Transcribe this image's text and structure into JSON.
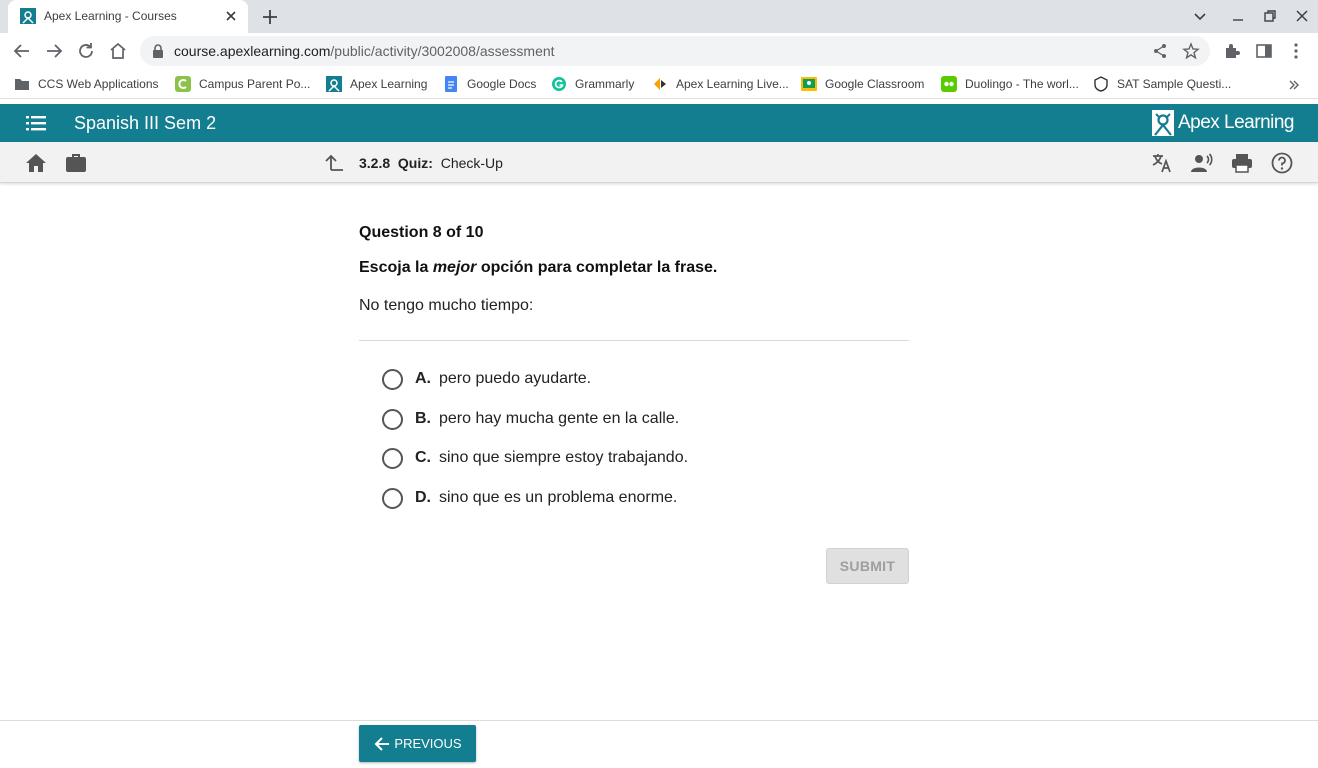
{
  "browser": {
    "tab_title": "Apex Learning - Courses",
    "url_host": "course.apexlearning.com",
    "url_path": "/public/activity/3002008/assessment"
  },
  "bookmarks": [
    {
      "label": "CCS Web Applications",
      "icon": "folder-icon"
    },
    {
      "label": "Campus Parent Po...",
      "icon": "campus-icon"
    },
    {
      "label": "Apex Learning",
      "icon": "apex-icon"
    },
    {
      "label": "Google Docs",
      "icon": "docs-icon"
    },
    {
      "label": "Grammarly",
      "icon": "grammarly-icon"
    },
    {
      "label": "Apex Learning Live...",
      "icon": "apex-live-icon"
    },
    {
      "label": "Google Classroom",
      "icon": "classroom-icon"
    },
    {
      "label": "Duolingo - The worl...",
      "icon": "duolingo-icon"
    },
    {
      "label": "SAT Sample Questi...",
      "icon": "sat-icon"
    }
  ],
  "header": {
    "course_title": "Spanish III Sem 2",
    "logo_text": "Apex Learning"
  },
  "breadcrumb": {
    "number": "3.2.8",
    "type": "Quiz:",
    "title": "Check-Up"
  },
  "question": {
    "counter": "Question 8 of 10",
    "instruction_pre": "Escoja la ",
    "instruction_em": "mejor",
    "instruction_post": " opción para completar la frase.",
    "prompt": "No tengo mucho tiempo:",
    "options": [
      {
        "letter": "A.",
        "text": "pero puedo ayudarte."
      },
      {
        "letter": "B.",
        "text": "pero hay mucha gente en la calle."
      },
      {
        "letter": "C.",
        "text": "sino que siempre estoy trabajando."
      },
      {
        "letter": "D.",
        "text": "sino que es un problema enorme."
      }
    ]
  },
  "actions": {
    "submit_label": "SUBMIT",
    "previous_label": "PREVIOUS"
  },
  "colors": {
    "brand_teal": "#137e8f",
    "submit_disabled_bg": "#e0e0e0"
  }
}
